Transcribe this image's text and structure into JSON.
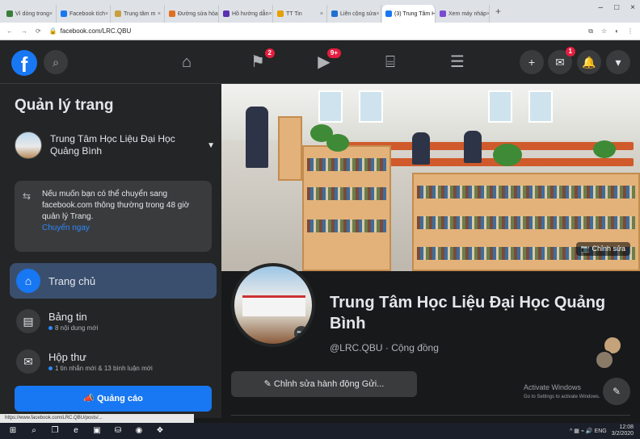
{
  "browser": {
    "tabs": [
      {
        "label": "Vì dòng trong",
        "color": "#3b7d3b",
        "active": false
      },
      {
        "label": "Facebook tích",
        "color": "#1877f2",
        "active": false
      },
      {
        "label": "Trung tâm m",
        "color": "#c8a040",
        "active": false
      },
      {
        "label": "Đường sửa hỏa",
        "color": "#e07020",
        "active": false
      },
      {
        "label": "Hồ hướng dẫn",
        "color": "#5a2fb0",
        "active": false
      },
      {
        "label": "TT Tin",
        "color": "#e6a000",
        "active": false
      },
      {
        "label": "Liên cộng sửa",
        "color": "#1f6fd0",
        "active": false
      },
      {
        "label": "(3) Trung Tâm H",
        "color": "#1877f2",
        "active": true
      },
      {
        "label": "Xem máy nháp",
        "color": "#7a4ad0",
        "active": false
      }
    ],
    "new_tab": "+",
    "window_controls": [
      "–",
      "□",
      "×"
    ],
    "address": "facebook.com/LRC.QBU",
    "nav": [
      "←",
      "→",
      "⟳"
    ]
  },
  "header": {
    "logo": "f",
    "search_icon": "⌕",
    "nav_icons": [
      {
        "name": "home-icon",
        "glyph": "⌂",
        "badge": ""
      },
      {
        "name": "flag-icon",
        "glyph": "⚑",
        "badge": "2"
      },
      {
        "name": "watch-icon",
        "glyph": "▶",
        "badge": "9+"
      },
      {
        "name": "marketplace-icon",
        "glyph": "⌸",
        "badge": ""
      },
      {
        "name": "menu-icon",
        "glyph": "☰",
        "badge": ""
      }
    ],
    "right_buttons": [
      {
        "name": "create-button",
        "glyph": "+",
        "badge": ""
      },
      {
        "name": "messenger-button",
        "glyph": "✉",
        "badge": "1"
      },
      {
        "name": "notifications-button",
        "glyph": "🔔",
        "badge": ""
      },
      {
        "name": "account-menu-button",
        "glyph": "▾",
        "badge": ""
      }
    ]
  },
  "sidebar": {
    "title": "Quản lý trang",
    "page_name": "Trung Tâm Học Liệu Đại Học Quảng Bình",
    "notice_text": "Nếu muốn bạn có thể chuyển sang facebook.com thông thường trong 48 giờ quản lý Trang.",
    "notice_link": "Chuyển ngay",
    "items": [
      {
        "label": "Trang chủ",
        "sub": "",
        "icon": "⌂",
        "active": true
      },
      {
        "label": "Bảng tin",
        "sub": "8 nội dung mới",
        "icon": "▤",
        "active": false
      },
      {
        "label": "Hộp thư",
        "sub": "1 tin nhắn mới & 13 bình luận mới",
        "icon": "✉",
        "active": false
      }
    ],
    "ad_button": "Quảng cáo",
    "ad_icon": "📣"
  },
  "main": {
    "edit_cover": "Chỉnh sửa",
    "page_title": "Trung Tâm Học Liệu Đại Học Quảng Bình",
    "handle": "@LRC.QBU · Cộng đồng",
    "edit_action_button": "Chỉnh sửa hành động Gửi...",
    "activate_title": "Activate Windows",
    "activate_sub": "Go to Settings to activate Windows."
  },
  "status_url": "https://www.facebook.com/LRC.QBU/posts/...",
  "taskbar": {
    "icons": [
      "⊞",
      "⌕",
      "❐",
      "e",
      "▣",
      "⛁",
      "◉",
      "❖"
    ],
    "tray": "^ ▦ ⌁ 🔊 ENG",
    "time": "12:08",
    "date": "3/2/2020"
  }
}
